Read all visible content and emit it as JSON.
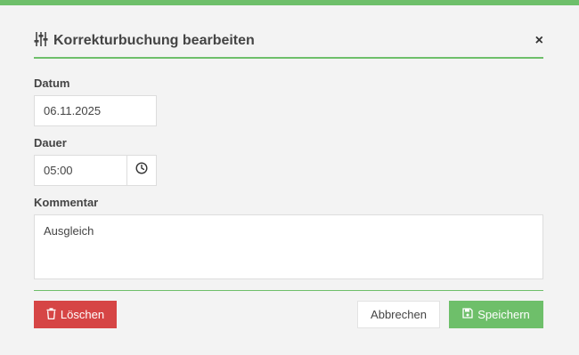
{
  "colors": {
    "accent": "#6ebf6a",
    "danger": "#d64545"
  },
  "dialog": {
    "title": "Korrekturbuchung bearbeiten",
    "title_icon": "sliders-icon",
    "close_label": "×"
  },
  "form": {
    "date": {
      "label": "Datum",
      "value": "06.11.2025"
    },
    "duration": {
      "label": "Dauer",
      "value": "05:00",
      "icon": "clock-icon"
    },
    "comment": {
      "label": "Kommentar",
      "value": "Ausgleich"
    }
  },
  "actions": {
    "delete_label": "Löschen",
    "delete_icon": "trash-icon",
    "cancel_label": "Abbrechen",
    "save_label": "Speichern",
    "save_icon": "floppy-disk-icon"
  }
}
